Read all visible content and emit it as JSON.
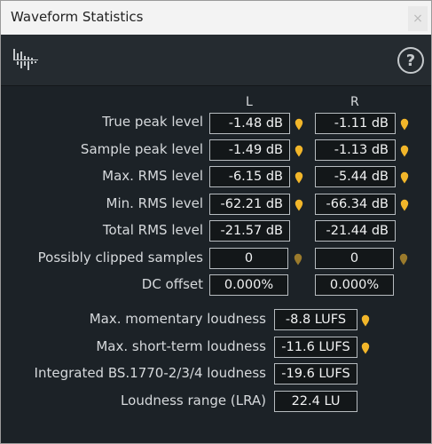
{
  "window": {
    "title": "Waveform Statistics",
    "close_glyph": "×"
  },
  "toolbar": {
    "help_glyph": "?"
  },
  "columns": {
    "left": "L",
    "right": "R"
  },
  "rows": [
    {
      "label": "True peak level",
      "left": "-1.48 dB",
      "right": "-1.11 dB",
      "marker": "active"
    },
    {
      "label": "Sample peak level",
      "left": "-1.49 dB",
      "right": "-1.13 dB",
      "marker": "active"
    },
    {
      "label": "Max. RMS level",
      "left": "-6.15 dB",
      "right": "-5.44 dB",
      "marker": "active"
    },
    {
      "label": "Min. RMS level",
      "left": "-62.21 dB",
      "right": "-66.34 dB",
      "marker": "active"
    },
    {
      "label": "Total RMS level",
      "left": "-21.57 dB",
      "right": "-21.44 dB",
      "marker": "none"
    },
    {
      "label": "Possibly clipped samples",
      "left": "0",
      "right": "0",
      "marker": "dim"
    },
    {
      "label": "DC offset",
      "left": "0.000%",
      "right": "0.000%",
      "marker": "none"
    }
  ],
  "loudness": [
    {
      "label": "Max. momentary loudness",
      "value": "-8.8 LUFS",
      "marker": "active"
    },
    {
      "label": "Max. short-term loudness",
      "value": "-11.6 LUFS",
      "marker": "active"
    },
    {
      "label": "Integrated BS.1770-2/3/4 loudness",
      "value": "-19.6 LUFS",
      "marker": "none"
    },
    {
      "label": "Loudness range (LRA)",
      "value": "22.4 LU",
      "marker": "none"
    }
  ],
  "colors": {
    "marker_active": "#f2b62a",
    "marker_dim": "#9a7a2c",
    "background": "#1c2227"
  }
}
